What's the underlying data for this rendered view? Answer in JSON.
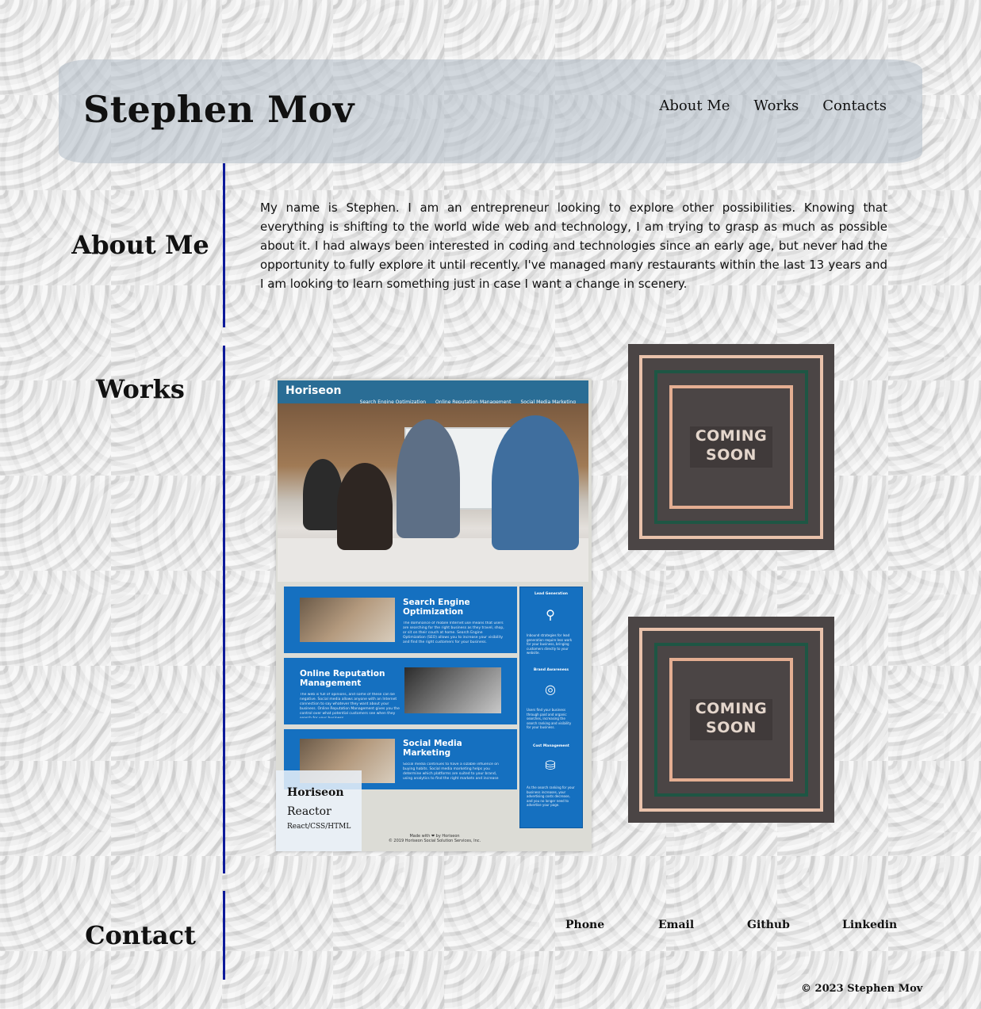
{
  "header": {
    "title": "Stephen Mov",
    "nav": [
      "About Me",
      "Works",
      "Contacts"
    ]
  },
  "about": {
    "heading": "About Me",
    "text": "My name is Stephen. I am an entrepreneur looking to explore other possibilities. Knowing that everything is shifting to the world wide web and technology, I am trying to grasp as much as possible about it. I had always been interested in coding and technologies since an early age, but never had the opportunity to fully explore it until recently. I've managed many restaurants within the last 13 years and I am looking to learn something just in case I want a change in scenery."
  },
  "works": {
    "heading": "Works",
    "project": {
      "screenshot": {
        "brand": "Horiseon",
        "menu": [
          "Search Engine Optimization",
          "Online Reputation Management",
          "Social Media Marketing"
        ],
        "cards": [
          {
            "title": "Search Engine Optimization",
            "text": "The dominance of mobile Internet use means that users are searching for the right business as they travel, shop, or sit on their couch at home. Search Engine Optimization (SEO) allows you to increase your visibility and find the right customers for your business."
          },
          {
            "title": "Online Reputation Management",
            "text": "The web is full of opinions, and some of these can be negative. Social media allows anyone with an Internet connection to say whatever they want about your business. Online Reputation Management gives you the control over what potential customers see when they search for your business."
          },
          {
            "title": "Social Media Marketing",
            "text": "Social media continues to have a sizable influence on buying habits. Social media marketing helps you determine which platforms are suited to your brand, using analytics to find the right markets and increase"
          }
        ],
        "side": [
          {
            "title": "Lead Generation",
            "text": "Inbound strategies for lead generation require less work for your business, bringing customers directly to your website."
          },
          {
            "title": "Brand Awareness",
            "text": "Users find your business through paid and organic searches, increasing the search ranking and visibility for your business."
          },
          {
            "title": "Cost Management",
            "text": "As the search ranking for your business increases, your advertising costs decrease, and you no longer need to advertise your page."
          }
        ],
        "footer_line1": "Made with ❤ by Horiseon",
        "footer_line2": "© 2019 Horiseon Social Solution Services, Inc."
      },
      "caption": {
        "name": "Horiseon",
        "subtitle": "Reactor",
        "tech": "React/CSS/HTML"
      }
    },
    "placeholders": [
      {
        "label_line1": "COMING",
        "label_line2": "SOON"
      },
      {
        "label_line1": "COMING",
        "label_line2": "SOON"
      }
    ]
  },
  "contact": {
    "heading": "Contact",
    "links": [
      "Phone",
      "Email",
      "Github",
      "Linkedin"
    ],
    "copyright": "© 2023 Stephen Mov"
  }
}
